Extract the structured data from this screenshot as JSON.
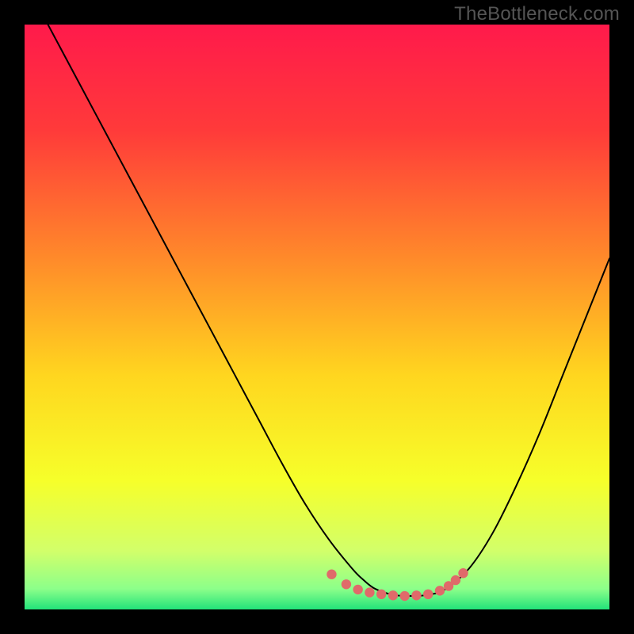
{
  "watermark": "TheBottleneck.com",
  "chart_data": {
    "type": "line",
    "title": "",
    "xlabel": "",
    "ylabel": "",
    "xlim": [
      0,
      100
    ],
    "ylim": [
      0,
      100
    ],
    "gradient_stops": [
      {
        "offset": 0,
        "color": "#ff1a4b"
      },
      {
        "offset": 0.18,
        "color": "#ff3a3a"
      },
      {
        "offset": 0.4,
        "color": "#ff8a2a"
      },
      {
        "offset": 0.6,
        "color": "#ffd61f"
      },
      {
        "offset": 0.78,
        "color": "#f6ff2a"
      },
      {
        "offset": 0.9,
        "color": "#d2ff6a"
      },
      {
        "offset": 0.965,
        "color": "#8cff8a"
      },
      {
        "offset": 1.0,
        "color": "#22e27a"
      }
    ],
    "series": [
      {
        "name": "bottleneck-curve",
        "stroke": "#000000",
        "stroke_width": 2.0,
        "x": [
          4,
          8,
          12,
          16,
          20,
          24,
          28,
          32,
          36,
          40,
          44,
          48,
          52,
          56,
          58,
          60,
          63,
          66,
          69,
          72,
          76,
          80,
          84,
          88,
          92,
          96,
          100
        ],
        "y": [
          100,
          92.5,
          85,
          77.5,
          70,
          62.5,
          55,
          47.5,
          40,
          32.5,
          25,
          18,
          12,
          7,
          5,
          3.5,
          2.5,
          2.3,
          2.5,
          3.5,
          7,
          13,
          21,
          30,
          40,
          50,
          60
        ]
      }
    ],
    "dots": {
      "name": "highlight-dots",
      "fill": "#e06a6a",
      "radius": 6.2,
      "x": [
        52.5,
        55,
        57,
        59,
        61,
        63,
        65,
        67,
        69,
        71,
        72.5,
        73.7,
        75
      ],
      "y": [
        6.0,
        4.3,
        3.4,
        2.9,
        2.6,
        2.4,
        2.3,
        2.4,
        2.6,
        3.2,
        4.0,
        5.0,
        6.2
      ]
    }
  }
}
